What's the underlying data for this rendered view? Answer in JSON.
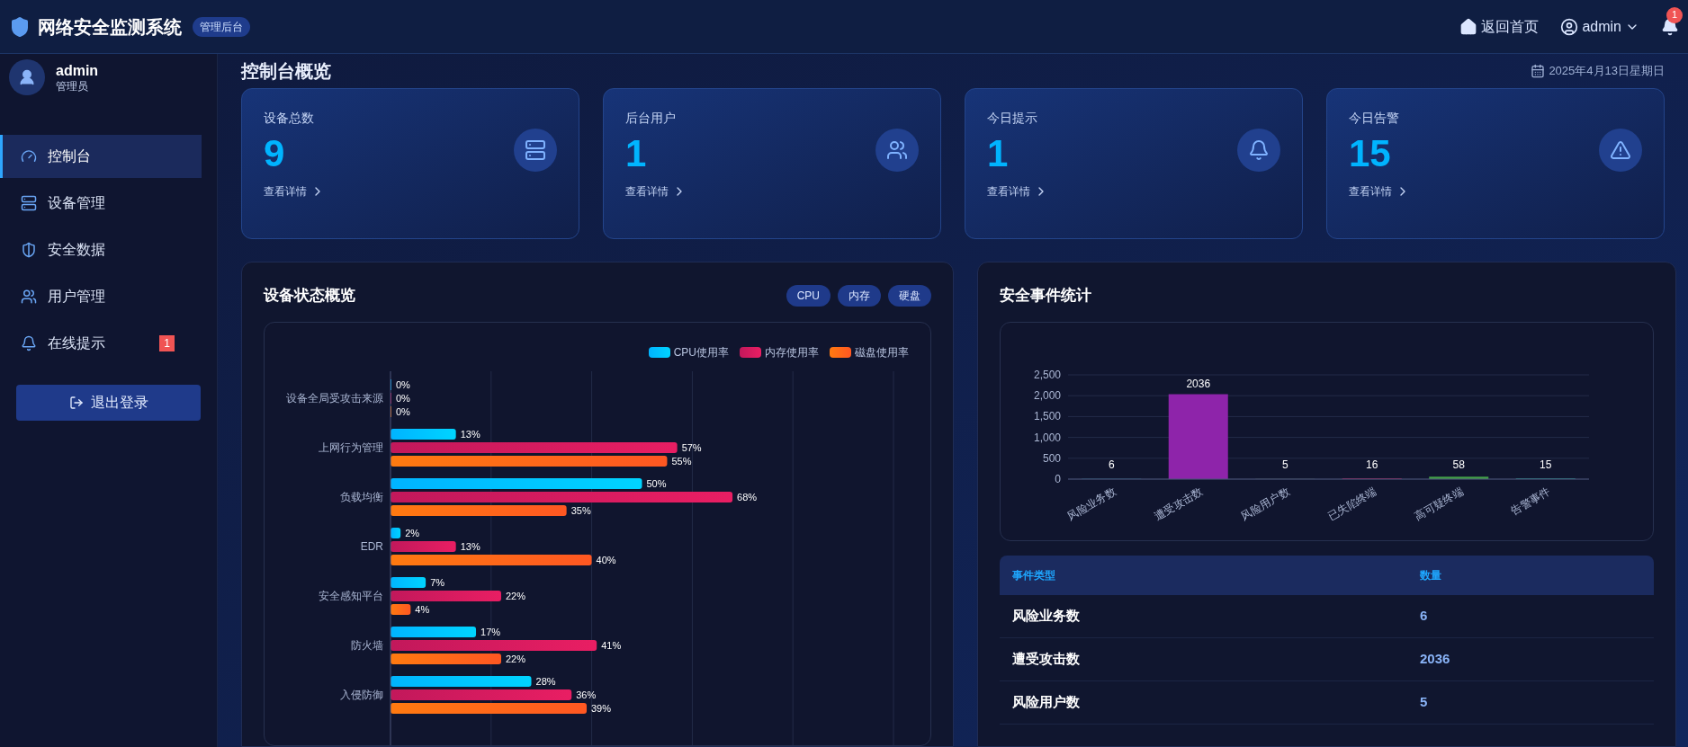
{
  "header": {
    "title": "网络安全监测系统",
    "badge": "管理后台",
    "home_link": "返回首页",
    "user": "admin",
    "notification_count": "1"
  },
  "sidebar": {
    "user": {
      "name": "admin",
      "role": "管理员"
    },
    "items": [
      {
        "label": "控制台",
        "selected": true
      },
      {
        "label": "设备管理",
        "selected": false
      },
      {
        "label": "安全数据",
        "selected": false
      },
      {
        "label": "用户管理",
        "selected": false
      },
      {
        "label": "在线提示",
        "selected": false,
        "badge": "1"
      }
    ],
    "logout": "退出登录"
  },
  "page": {
    "title": "控制台概览",
    "date": "2025年4月13日星期日"
  },
  "stats": [
    {
      "label": "设备总数",
      "value": "9",
      "link": "查看详情"
    },
    {
      "label": "后台用户",
      "value": "1",
      "link": "查看详情"
    },
    {
      "label": "今日提示",
      "value": "1",
      "link": "查看详情"
    },
    {
      "label": "今日告警",
      "value": "15",
      "link": "查看详情"
    }
  ],
  "device_panel": {
    "title": "设备状态概览",
    "chips": [
      "CPU",
      "内存",
      "硬盘"
    ],
    "chart_data": {
      "type": "bar",
      "orientation": "horizontal",
      "categories": [
        "设备全局受攻击来源",
        "上网行为管理",
        "负载均衡",
        "EDR",
        "安全感知平台",
        "防火墙",
        "入侵防御"
      ],
      "xlim": [
        0,
        100
      ],
      "data_labels": true,
      "legend": "upper right",
      "grid": true,
      "series": [
        {
          "name": "CPU使用率",
          "color": "#00b4ff",
          "values": [
            0,
            13,
            50,
            2,
            7,
            17,
            28
          ],
          "value_labels": [
            "0%",
            "13%",
            "50%",
            "2%",
            "7%",
            "17%",
            "28%"
          ]
        },
        {
          "name": "内存使用率",
          "color": "#c2185b",
          "values": [
            0,
            57,
            68,
            13,
            22,
            41,
            36
          ],
          "value_labels": [
            "0%",
            "57%",
            "68%",
            "13%",
            "22%",
            "41%",
            "36%"
          ]
        },
        {
          "name": "磁盘使用率",
          "color": "#ff7a10",
          "values": [
            0,
            55,
            35,
            40,
            4,
            22,
            39
          ],
          "value_labels": [
            "0%",
            "55%",
            "35%",
            "40%",
            "4%",
            "22%",
            "39%"
          ]
        }
      ]
    }
  },
  "event_panel": {
    "title": "安全事件统计",
    "chart_data": {
      "type": "bar",
      "categories": [
        "风险业务数",
        "遭受攻击数",
        "风险用户数",
        "已失陷终端",
        "高可疑终端",
        "告警事件"
      ],
      "ylim": [
        0,
        2500
      ],
      "grid": true,
      "yticks": [
        {
          "value": 0,
          "label": "0"
        },
        {
          "value": 500,
          "label": "500"
        },
        {
          "value": 1000,
          "label": "1,000"
        },
        {
          "value": 1500,
          "label": "1,500"
        },
        {
          "value": 2000,
          "label": "2,000"
        },
        {
          "value": 2500,
          "label": "2,500"
        }
      ],
      "data_labels": true,
      "series": [
        {
          "values": [
            6,
            2036,
            5,
            16,
            58,
            15
          ],
          "value_labels": [
            "6",
            "2036",
            "5",
            "16",
            "58",
            "15"
          ],
          "colors": [
            "#1e8aa0",
            "#8e24aa",
            "#5a6b55",
            "#c2185b",
            "#43a047",
            "#26a69a"
          ]
        }
      ]
    },
    "table": {
      "columns": [
        "事件类型",
        "数量"
      ],
      "rows": [
        [
          "风险业务数",
          "6"
        ],
        [
          "遭受攻击数",
          "2036"
        ],
        [
          "风险用户数",
          "5"
        ]
      ]
    }
  }
}
